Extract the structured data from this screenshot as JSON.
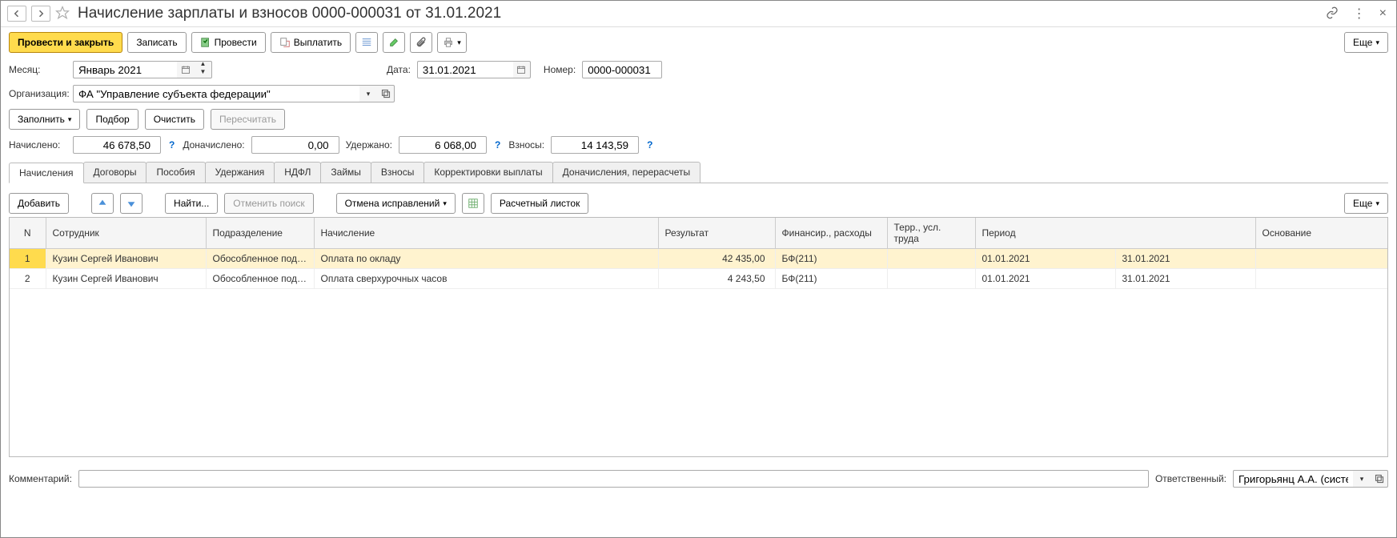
{
  "title": "Начисление зарплаты и взносов 0000-000031 от 31.01.2021",
  "toolbar": {
    "post_close": "Провести и закрыть",
    "write": "Записать",
    "post": "Провести",
    "pay": "Выплатить",
    "more": "Еще"
  },
  "fields": {
    "month_label": "Месяц:",
    "month_value": "Январь 2021",
    "date_label": "Дата:",
    "date_value": "31.01.2021",
    "number_label": "Номер:",
    "number_value": "0000-000031",
    "org_label": "Организация:",
    "org_value": "ФА \"Управление субъекта федерации\"",
    "fill": "Заполнить",
    "select": "Подбор",
    "clear": "Очистить",
    "recalc": "Пересчитать",
    "accrued_label": "Начислено:",
    "accrued_value": "46 678,50",
    "additional_label": "Доначислено:",
    "additional_value": "0,00",
    "withheld_label": "Удержано:",
    "withheld_value": "6 068,00",
    "contrib_label": "Взносы:",
    "contrib_value": "14 143,59"
  },
  "tabs": [
    "Начисления",
    "Договоры",
    "Пособия",
    "Удержания",
    "НДФЛ",
    "Займы",
    "Взносы",
    "Корректировки выплаты",
    "Доначисления, перерасчеты"
  ],
  "tab_toolbar": {
    "add": "Добавить",
    "find": "Найти...",
    "cancel_find": "Отменить поиск",
    "cancel_fix": "Отмена исправлений",
    "payslip": "Расчетный листок",
    "more": "Еще"
  },
  "columns": {
    "n": "N",
    "employee": "Сотрудник",
    "dept": "Подразделение",
    "accrual": "Начисление",
    "result": "Результат",
    "finance": "Финансир., расходы",
    "terr": "Терр., усл. труда",
    "period": "Период",
    "basis": "Основание"
  },
  "rows": [
    {
      "n": "1",
      "employee": "Кузин Сергей Иванович",
      "dept": "Обособленное подр…",
      "accrual": "Оплата по окладу",
      "result": "42 435,00",
      "finance": "БФ(211)",
      "period_from": "01.01.2021",
      "period_to": "31.01.2021"
    },
    {
      "n": "2",
      "employee": "Кузин Сергей Иванович",
      "dept": "Обособленное подр…",
      "accrual": "Оплата сверхурочных часов",
      "result": "4 243,50",
      "finance": "БФ(211)",
      "period_from": "01.01.2021",
      "period_to": "31.01.2021"
    }
  ],
  "footer": {
    "comment_label": "Комментарий:",
    "comment_value": "",
    "responsible_label": "Ответственный:",
    "responsible_value": "Григорьянц А.А. (системн"
  }
}
